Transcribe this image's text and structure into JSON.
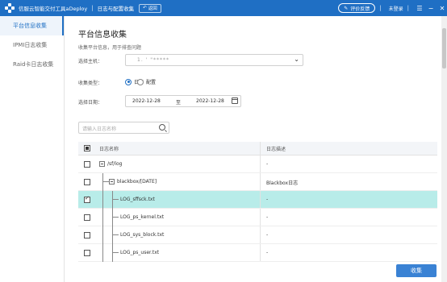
{
  "titlebar": {
    "app_title": "信服云智能交付工具aDeploy",
    "separator": "|",
    "sub_title": "日志与配置收集",
    "back_label": "返回",
    "feedback_label": "评价反馈",
    "login_status": "未登录"
  },
  "sidebar": {
    "items": [
      {
        "label": "平台信息收集"
      },
      {
        "label": "IPMI日志收集"
      },
      {
        "label": "Raid卡日志收集"
      }
    ]
  },
  "main": {
    "title": "平台信息收集",
    "description": "收集平台信息，用于排查问题",
    "host_label": "选择主机：",
    "host_value": "1.  '  \"*****",
    "type_label": "收集类型：",
    "type_options": [
      {
        "label": "日志",
        "selected": true
      },
      {
        "label": "配置",
        "selected": false
      }
    ],
    "date_label": "选择日期：",
    "date_from": "2022-12-28",
    "date_to_sep": "至",
    "date_to": "2022-12-28",
    "search_placeholder": "请输入日志名称"
  },
  "table": {
    "headers": [
      "日志名称",
      "日志描述"
    ],
    "rows": [
      {
        "name": "/sf/log",
        "desc": "-",
        "checked": false
      },
      {
        "name": "blackbox/[DATE]",
        "desc": "Blackbox日志",
        "checked": false
      },
      {
        "name": "LOG_sffsck.txt",
        "desc": "-",
        "checked": true
      },
      {
        "name": "LOG_ps_kernel.txt",
        "desc": "-",
        "checked": false
      },
      {
        "name": "LOG_sys_block.txt",
        "desc": "-",
        "checked": false
      },
      {
        "name": "LOG_ps_user.txt",
        "desc": "-",
        "checked": false
      }
    ]
  },
  "footer": {
    "collect_label": "收集"
  },
  "colors": {
    "primary": "#1f6fc4",
    "selected_row": "#b8ece9",
    "button": "#3a82d4"
  }
}
